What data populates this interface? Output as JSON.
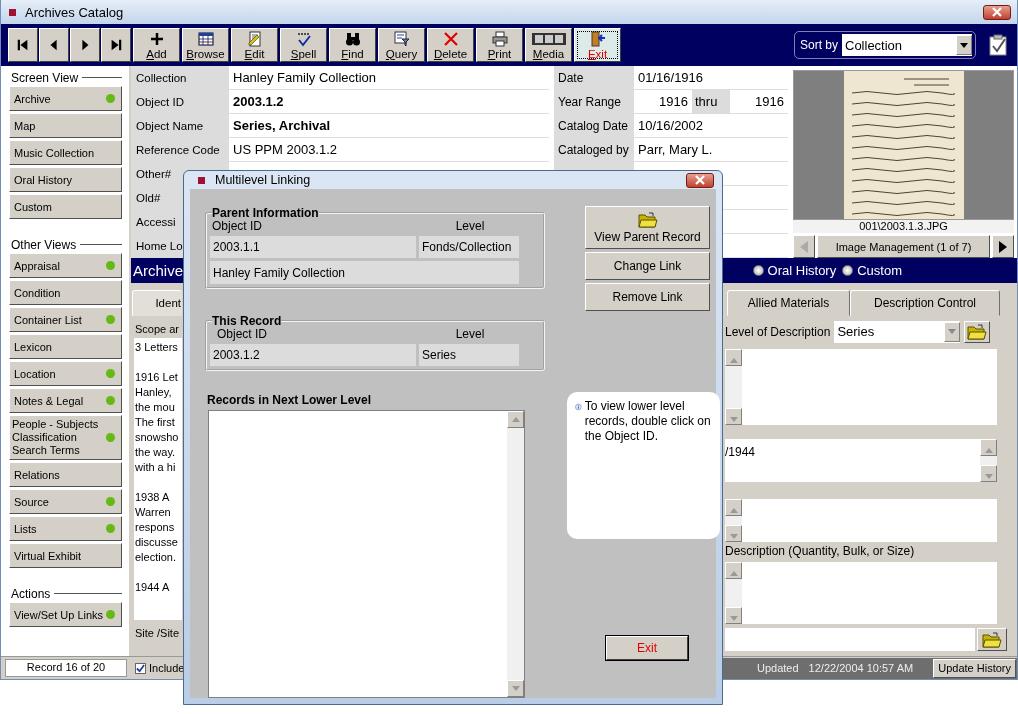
{
  "window": {
    "title": "Archives Catalog"
  },
  "toolbar": {
    "nav_buttons": [
      {
        "kind": "first"
      },
      {
        "kind": "prev"
      },
      {
        "kind": "next"
      },
      {
        "kind": "last"
      }
    ],
    "tools": [
      {
        "label": "Add",
        "kind": "add",
        "focused": false
      },
      {
        "label": "Browse",
        "kind": "browse",
        "focused": false
      },
      {
        "label": "Edit",
        "kind": "edit",
        "focused": false
      },
      {
        "label": "Spell",
        "kind": "spell",
        "focused": false
      },
      {
        "label": "Find",
        "kind": "find",
        "focused": false
      },
      {
        "label": "Query",
        "kind": "query",
        "focused": false
      },
      {
        "label": "Delete",
        "kind": "delete",
        "focused": false
      },
      {
        "label": "Print",
        "kind": "print",
        "focused": false
      },
      {
        "label": "Media",
        "kind": "media",
        "focused": false
      },
      {
        "label": "Exit",
        "kind": "exit",
        "focused": true
      }
    ],
    "sort": {
      "label": "Sort by",
      "value": "Collection"
    }
  },
  "sidebar": {
    "sections": [
      {
        "title": "Screen View",
        "items": [
          {
            "label": "Archive",
            "has_data": true
          },
          {
            "label": "Map",
            "has_data": false
          },
          {
            "label": "Music Collection",
            "has_data": false
          },
          {
            "label": "Oral History",
            "has_data": false
          },
          {
            "label": "Custom",
            "has_data": false
          }
        ]
      },
      {
        "title": "Other Views",
        "items": [
          {
            "label": "Appraisal",
            "has_data": true
          },
          {
            "label": "Condition",
            "has_data": false
          },
          {
            "label": "Container List",
            "has_data": true
          },
          {
            "label": "Lexicon",
            "has_data": false
          },
          {
            "label": "Location",
            "has_data": true
          },
          {
            "label": "Notes & Legal",
            "has_data": true
          },
          {
            "label": "People - Subjects\nClassification\nSearch Terms",
            "has_data": true
          },
          {
            "label": "Relations",
            "has_data": false
          },
          {
            "label": "Source",
            "has_data": true
          },
          {
            "label": "Lists",
            "has_data": true
          },
          {
            "label": "Virtual Exhibit",
            "has_data": false
          }
        ]
      },
      {
        "title": "Actions",
        "items": [
          {
            "label": "View/Set Up Links",
            "has_data": true
          }
        ]
      }
    ]
  },
  "record": {
    "left_fields": [
      {
        "label": "Collection",
        "value": "Hanley Family Collection",
        "bold": false
      },
      {
        "label": "Object ID",
        "value": "2003.1.2",
        "bold": true
      },
      {
        "label": "Object Name",
        "value": "Series, Archival",
        "bold": true
      },
      {
        "label": "Reference Code",
        "value": "US PPM 2003.1.2",
        "bold": false
      },
      {
        "label": "Other#"
      },
      {
        "label": "Old#"
      },
      {
        "label": "Accessi"
      },
      {
        "label": "Home Lo"
      }
    ],
    "right_fields": [
      {
        "label": "Date",
        "kind": "text",
        "value": "01/16/1916"
      },
      {
        "label": "Year Range",
        "kind": "range",
        "from": "1916",
        "joiner": "thru",
        "to": "1916"
      },
      {
        "label": "Catalog Date",
        "kind": "text",
        "value": "10/16/2002"
      },
      {
        "label": "Cataloged by",
        "kind": "text",
        "value": "Parr, Mary L."
      }
    ]
  },
  "image": {
    "caption": "001\\2003.1.3.JPG",
    "button": "Image Management (1 of 7)"
  },
  "view_band": {
    "title": "Archive",
    "options": [
      {
        "label": "Oral History",
        "selected": false
      },
      {
        "label": "Custom",
        "selected": false
      }
    ]
  },
  "tabs": [
    {
      "label": "Ident",
      "selected": true
    },
    {
      "label": "Allied Materials",
      "selected": false
    },
    {
      "label": "Description Control",
      "selected": false
    }
  ],
  "scope": {
    "label": "Scope ar",
    "paragraphs": [
      [
        "3 Letters"
      ],
      [
        "1916 Let",
        "Hanley,",
        "the mou",
        "The first",
        "snowsho",
        "the way.",
        "with a hi"
      ],
      [
        "1938 A",
        "Warren",
        "respons",
        "discusse",
        "election."
      ],
      [
        "1944 A"
      ]
    ]
  },
  "site_label": "Site /Site",
  "description": {
    "level_label": "Level of Description",
    "level_value": "Series",
    "date_text": "/1944",
    "extent_label": "Description (Quantity, Bulk, or Size)"
  },
  "status": {
    "record": "Record 16 of 20",
    "include": {
      "label": "Include",
      "checked": true
    },
    "updated_label": "Updated",
    "updated": "12/22/2004 10:57 AM",
    "history_button": "Update History"
  },
  "dialog": {
    "title": "Multilevel Linking",
    "parent": {
      "title": "Parent Information",
      "id_header": "Object ID",
      "level_header": "Level",
      "id": "2003.1.1",
      "level": "Fonds/Collection",
      "name": "Hanley Family Collection"
    },
    "this_record": {
      "title": "This Record",
      "id_header": "Object ID",
      "level_header": "Level",
      "id": "2003.1.2",
      "level": "Series"
    },
    "lower_title": "Records in Next Lower Level",
    "buttons": [
      {
        "label": "View Parent Record",
        "kind": "folder"
      },
      {
        "label": "Change Link",
        "kind": "plain"
      },
      {
        "label": "Remove Link",
        "kind": "plain"
      }
    ],
    "info": "To view lower level records, double click on the Object ID.",
    "exit": "Exit"
  }
}
